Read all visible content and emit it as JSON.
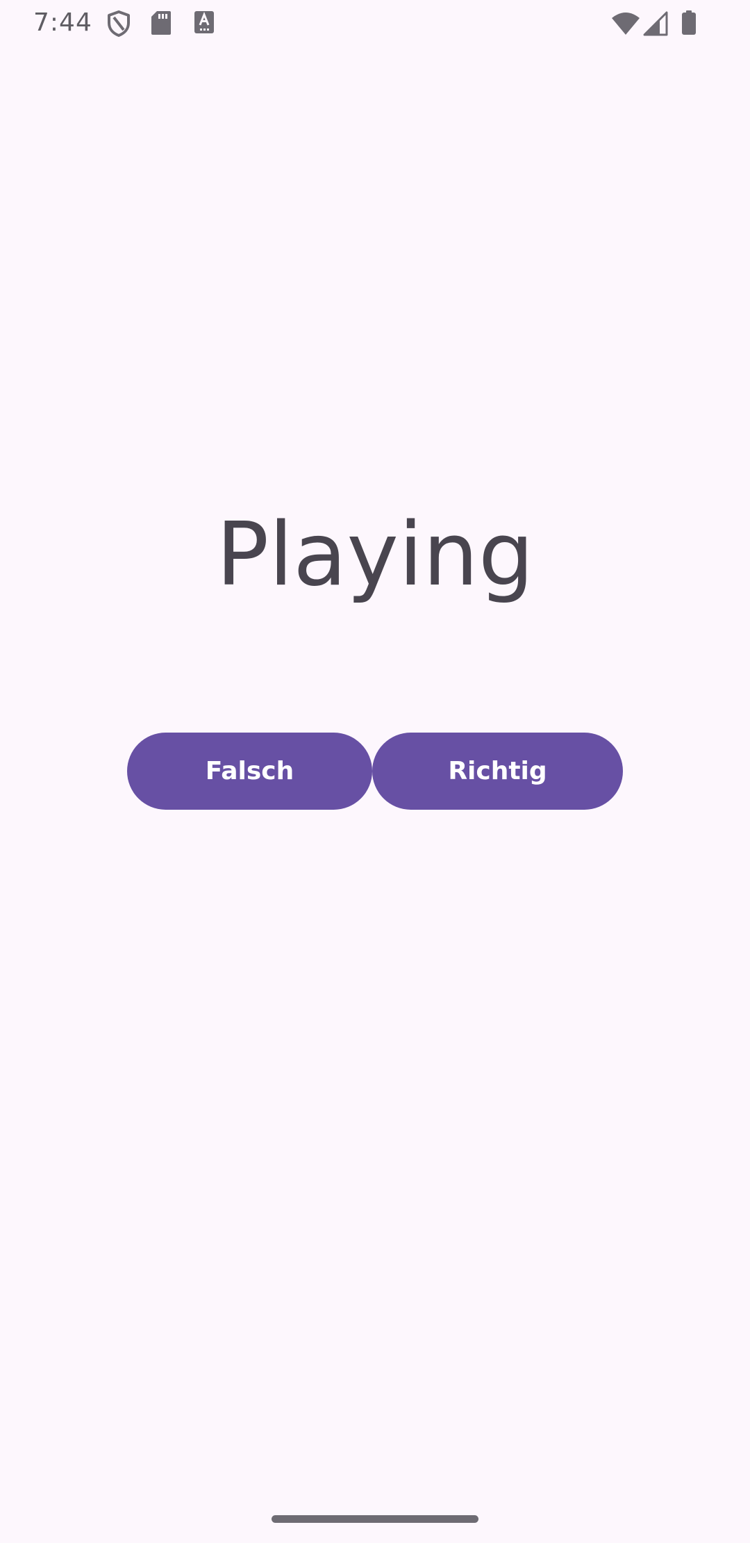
{
  "status_bar": {
    "time": "7:44",
    "icons": [
      "shield-icon",
      "sd-card-icon",
      "keyboard-a-icon",
      "wifi-icon",
      "cell-signal-icon",
      "battery-icon"
    ],
    "icon_color": "#6E6B73"
  },
  "main": {
    "title": "Playing",
    "title_color": "#49454F",
    "buttons": [
      {
        "label": "Falsch"
      },
      {
        "label": "Richtig"
      }
    ],
    "button_color": "#6750A4",
    "button_text_color": "#FFFFFF"
  },
  "background_color": "#FDF7FD"
}
